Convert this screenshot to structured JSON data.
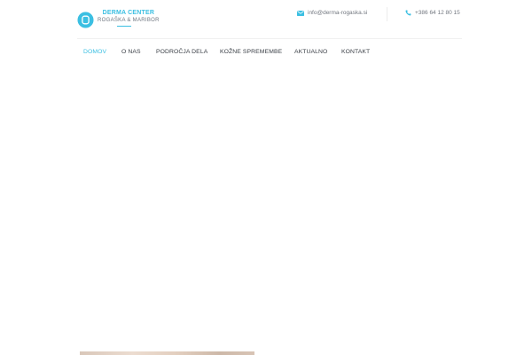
{
  "brand": {
    "name": "DERMA CENTER",
    "tagline": "ROGAŠKA & MARIBOR",
    "icon": "logo-icon",
    "accent_color": "#3bbfe2"
  },
  "contacts": {
    "email": {
      "icon": "envelope-icon",
      "text": "info@derma-rogaska.si"
    },
    "phone": {
      "icon": "phone-icon",
      "text": "+386 64 12 80 15"
    }
  },
  "nav": {
    "items": [
      {
        "label": "DOMOV",
        "active": true
      },
      {
        "label": "O NAS",
        "active": false
      },
      {
        "label": "PODROČJA DELA",
        "active": false
      },
      {
        "label": "KOŽNE SPREMEMBE",
        "active": false
      },
      {
        "label": "AKTUALNO",
        "active": false
      },
      {
        "label": "KONTAKT",
        "active": false
      }
    ]
  }
}
